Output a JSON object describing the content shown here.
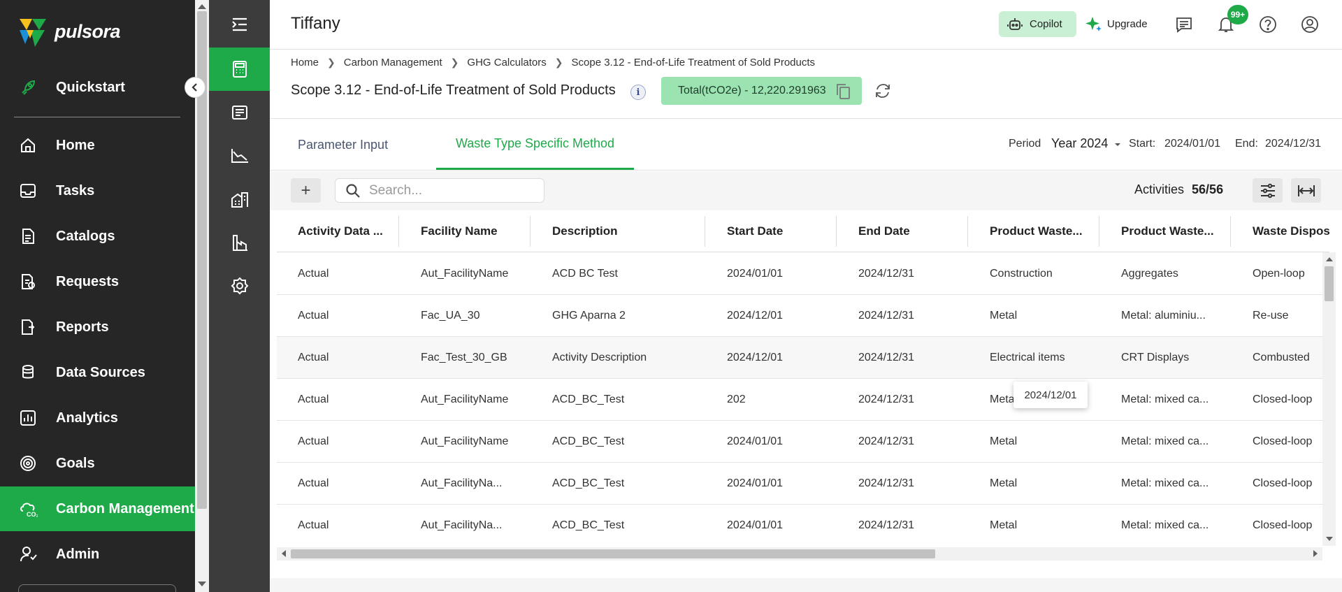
{
  "brand": {
    "name": "pulsora"
  },
  "sidebar": {
    "items": [
      {
        "label": "Quickstart",
        "icon": "rocket-icon"
      },
      {
        "label": "Home",
        "icon": "home-icon"
      },
      {
        "label": "Tasks",
        "icon": "inbox-icon"
      },
      {
        "label": "Catalogs",
        "icon": "catalog-icon"
      },
      {
        "label": "Requests",
        "icon": "requests-icon"
      },
      {
        "label": "Reports",
        "icon": "reports-icon"
      },
      {
        "label": "Data Sources",
        "icon": "database-icon"
      },
      {
        "label": "Analytics",
        "icon": "analytics-icon"
      },
      {
        "label": "Goals",
        "icon": "goals-icon"
      },
      {
        "label": "Carbon Management",
        "icon": "carbon-cloud-icon",
        "active": true
      },
      {
        "label": "Admin",
        "icon": "admin-icon"
      }
    ]
  },
  "rail": {
    "items": [
      "calculator-icon",
      "ledger-icon",
      "trend-chart-icon",
      "buildings-icon",
      "factory-icon",
      "settings-gear-icon"
    ],
    "active_index": 0
  },
  "topbar": {
    "user_title": "Tiffany",
    "copilot_label": "Copilot",
    "upgrade_label": "Upgrade",
    "notifications_badge": "99+"
  },
  "header": {
    "breadcrumb": [
      "Home",
      "Carbon Management",
      "GHG Calculators",
      "Scope 3.12 - End-of-Life Treatment of Sold Products"
    ],
    "title": "Scope 3.12 - End-of-Life Treatment of Sold Products",
    "info_label": "i",
    "total_label": "Total(tCO2e) - 12,220.291963"
  },
  "tabs": {
    "items": [
      "Parameter Input",
      "Waste Type Specific Method"
    ],
    "active_index": 1,
    "period_label": "Period",
    "period_value": "Year 2024",
    "start_label": "Start:",
    "start_value": "2024/01/01",
    "end_label": "End:",
    "end_value": "2024/12/31"
  },
  "toolbar": {
    "add_label": "+",
    "search_placeholder": "Search...",
    "activities_label": "Activities",
    "activities_count": "56/56"
  },
  "table": {
    "columns": [
      "Activity Data ...",
      "Facility Name",
      "Description",
      "Start Date",
      "End Date",
      "Product Waste...",
      "Product Waste...",
      "Waste Disposa..."
    ],
    "rows": [
      [
        "Actual",
        "Aut_FacilityName",
        "ACD BC Test",
        "2024/01/01",
        "2024/12/31",
        "Construction",
        "Aggregates",
        "Open-loop"
      ],
      [
        "Actual",
        "Fac_UA_30",
        "GHG Aparna 2",
        "2024/12/01",
        "2024/12/31",
        "Metal",
        "Metal: aluminiu...",
        "Re-use"
      ],
      [
        "Actual",
        "Fac_Test_30_GB",
        "Activity Description",
        "2024/12/01",
        "2024/12/31",
        "Electrical items",
        "CRT Displays",
        "Combusted"
      ],
      [
        "Actual",
        "Aut_FacilityName",
        "ACD_BC_Test",
        "202",
        "2024/12/31",
        "Metal",
        "Metal: mixed ca...",
        "Closed-loop"
      ],
      [
        "Actual",
        "Aut_FacilityName",
        "ACD_BC_Test",
        "2024/01/01",
        "2024/12/31",
        "Metal",
        "Metal: mixed ca...",
        "Closed-loop"
      ],
      [
        "Actual",
        "Aut_FacilityNa...",
        "ACD_BC_Test",
        "2024/01/01",
        "2024/12/31",
        "Metal",
        "Metal: mixed ca...",
        "Closed-loop"
      ],
      [
        "Actual",
        "Aut_FacilityNa...",
        "ACD_BC_Test",
        "2024/01/01",
        "2024/12/31",
        "Metal",
        "Metal: mixed ca...",
        "Closed-loop"
      ]
    ],
    "tooltip": "2024/12/01"
  },
  "colors": {
    "accent": "#1faa4a",
    "sidebar_bg": "#262626",
    "rail_bg": "#3c3c3c",
    "total_chip_bg": "#9be3b0",
    "copilot_bg": "#c9f0d4"
  }
}
